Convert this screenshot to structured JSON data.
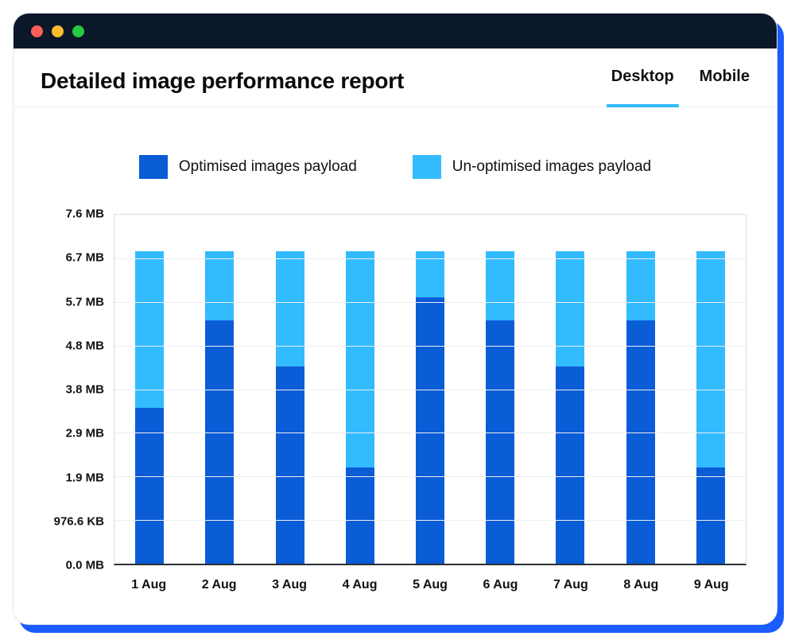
{
  "header": {
    "title": "Detailed image performance report",
    "tabs": [
      {
        "label": "Desktop",
        "active": true
      },
      {
        "label": "Mobile",
        "active": false
      }
    ]
  },
  "legend": {
    "optimised": "Optimised images payload",
    "unoptimised": "Un-optimised images payload"
  },
  "chart_data": {
    "type": "bar",
    "stacked": true,
    "categories": [
      "1 Aug",
      "2 Aug",
      "3 Aug",
      "4 Aug",
      "5 Aug",
      "6 Aug",
      "7 Aug",
      "8 Aug",
      "9 Aug"
    ],
    "series": [
      {
        "name": "Optimised images payload",
        "color": "#0b5cd7",
        "values": [
          3.4,
          5.3,
          4.3,
          2.1,
          5.8,
          5.3,
          4.3,
          5.3,
          2.1
        ]
      },
      {
        "name": "Un-optimised images payload",
        "color": "#33bbff",
        "values": [
          3.4,
          1.5,
          2.5,
          4.7,
          1.0,
          1.5,
          2.5,
          1.5,
          4.7
        ]
      }
    ],
    "ylim": [
      0,
      7.6
    ],
    "y_ticks": [
      "0.0 MB",
      "976.6 KB",
      "1.9 MB",
      "2.9 MB",
      "3.8 MB",
      "4.8 MB",
      "5.7 MB",
      "6.7 MB",
      "7.6 MB"
    ],
    "xlabel": "",
    "ylabel": "",
    "title": ""
  }
}
